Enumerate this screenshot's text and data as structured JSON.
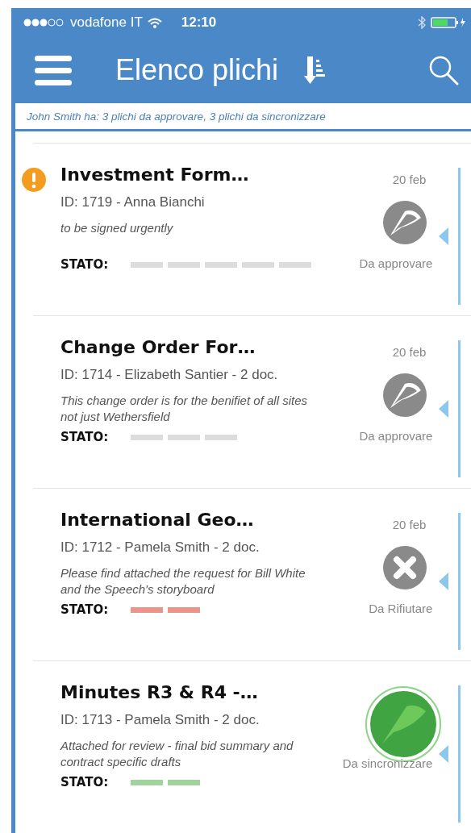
{
  "status_bar": {
    "carrier": "vodafone IT",
    "time": "12:10"
  },
  "header": {
    "title": "Elenco plichi"
  },
  "summary": "John Smith ha: 3 plichi da approvare, 3 plichi da sincronizzare",
  "items": [
    {
      "title": "Investment Form…",
      "urgent": true,
      "meta": "ID: 1719 - Anna Bianchi",
      "note": "to be signed urgently",
      "stato_label": "STATO:",
      "stato": [
        {
          "color": "#dcdcdc"
        },
        {
          "color": "#dcdcdc"
        },
        {
          "color": "#dcdcdc"
        },
        {
          "color": "#dcdcdc"
        },
        {
          "color": "#dcdcdc"
        }
      ],
      "date": "20 feb",
      "kind": "approve",
      "status": "Da approvare"
    },
    {
      "title": "Change Order For…",
      "urgent": false,
      "meta": "ID: 1714 - Elizabeth Santier - 2 doc.",
      "note": "This change order is for the benifiet of all sites not just Wethersfield",
      "stato_label": "STATO:",
      "stato": [
        {
          "color": "#dcdcdc"
        },
        {
          "color": "#dcdcdc"
        },
        {
          "color": "#dcdcdc"
        }
      ],
      "date": "20 feb",
      "kind": "approve",
      "status": "Da approvare"
    },
    {
      "title": "International Geo…",
      "urgent": false,
      "meta": "ID: 1712 - Pamela Smith - 2 doc.",
      "note": "Please find attached the request for Bill White and the Speech's storyboard",
      "stato_label": "STATO:",
      "stato": [
        {
          "color": "#ec9489"
        },
        {
          "color": "#ec9489"
        }
      ],
      "date": "20 feb",
      "kind": "reject",
      "status": "Da Rifiutare"
    },
    {
      "title": "Minutes R3 & R4 -…",
      "urgent": false,
      "meta": "ID: 1713 - Pamela Smith - 2 doc.",
      "note": "Attached for review - final bid summary and contract specific drafts",
      "stato_label": "STATO:",
      "stato": [
        {
          "color": "#9fd49a"
        },
        {
          "color": "#9fd49a"
        }
      ],
      "kind": "sync",
      "status": "Da sincronizzare"
    }
  ]
}
